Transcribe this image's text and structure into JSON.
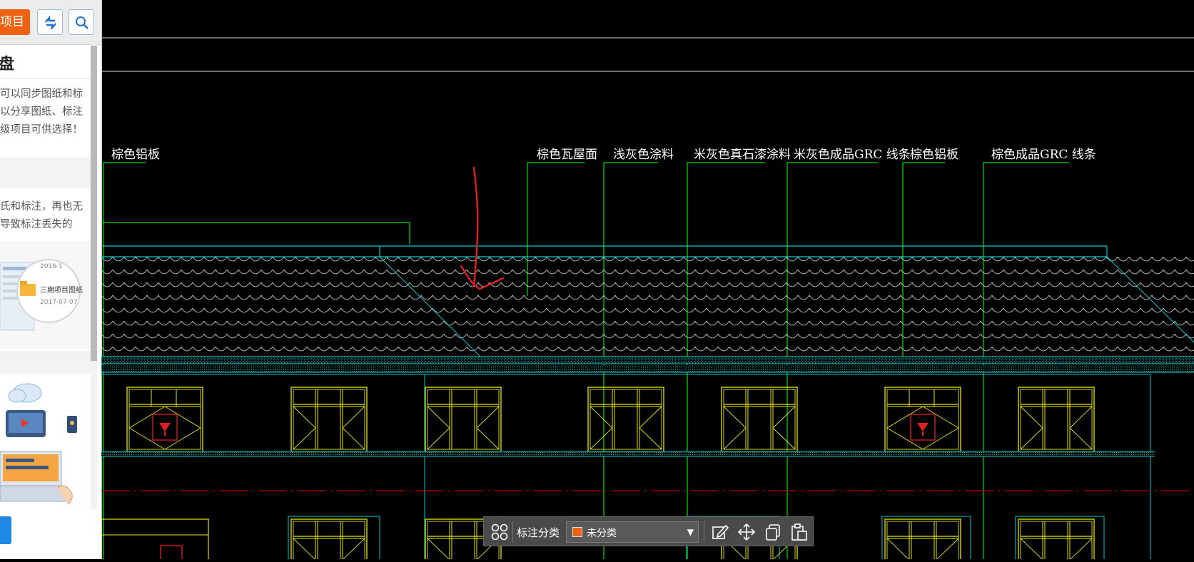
{
  "sidebar": {
    "project_button": "项目",
    "sync_icon": "sync-icon",
    "search_icon": "search-icon",
    "card1": {
      "title": "盘",
      "lines": [
        "可以同步图纸和标",
        "以分享图纸、标注",
        "级项目可供选择！"
      ]
    },
    "card2": {
      "lines": [
        "氏和标注，再也无",
        "导致标注丢失的"
      ],
      "illustration": {
        "date_top": "2016-1",
        "folder_label": "三期项目图纸",
        "date_bottom": "2017-07-07"
      }
    },
    "card3": {
      "illustration": "cloud-devices-illustration"
    }
  },
  "drawing": {
    "labels": [
      "棕色铝板",
      "棕色瓦屋面",
      "浅灰色涂料",
      "米灰色真石漆涂料",
      "米灰色成品GRC 线条",
      "棕色铝板",
      "棕色成品GRC 线条"
    ],
    "colors": {
      "background": "#000000",
      "leader": "#00e000",
      "outline": "#00cccc",
      "window": "#e6e600",
      "axis": "#e00000",
      "markup": "#e02020"
    }
  },
  "toolbar": {
    "grid_icon": "layout-grid-icon",
    "label": "标注分类",
    "select_value": "未分类",
    "swatch_color": "#f0620f",
    "icons": [
      "edit-icon",
      "move-icon",
      "copy-icon",
      "paste-icon"
    ]
  }
}
